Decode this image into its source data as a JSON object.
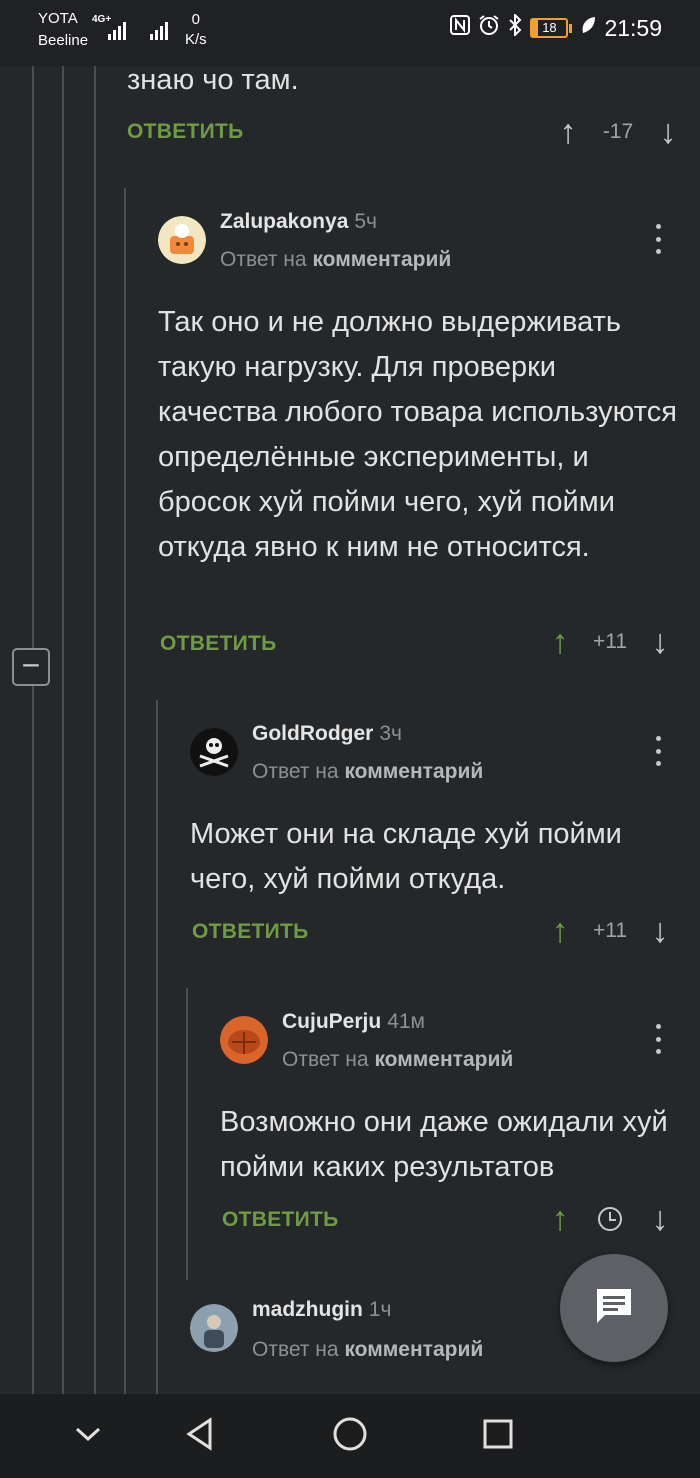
{
  "status_bar": {
    "carrier1": "YOTA",
    "carrier2": "Beeline",
    "network_type": "4G+",
    "speed_value": "0",
    "speed_unit": "K/s",
    "battery": "18",
    "time": "21:59"
  },
  "top_comment": {
    "text_tail": "знаю чо там.",
    "reply_label": "ОТВЕТИТЬ",
    "rating": "-17"
  },
  "comments": [
    {
      "username": "Zalupakonya",
      "time_ago": "5ч",
      "reply_prefix": "Ответ на",
      "reply_target": "комментарий",
      "text": "Так оно и не должно выдерживать такую нагрузку. Для проверки качества любого товара используются определённые эксперименты, и бросок хуй пойми чего, хуй пойми откуда явно к ним не относится.",
      "reply_label": "ОТВЕТИТЬ",
      "rating": "+11"
    },
    {
      "username": "GoldRodger",
      "time_ago": "3ч",
      "reply_prefix": "Ответ на",
      "reply_target": "комментарий",
      "text": "Может они на складе хуй пойми чего, хуй пойми откуда.",
      "reply_label": "ОТВЕТИТЬ",
      "rating": "+11"
    },
    {
      "username": "CujuPerju",
      "time_ago": "41м",
      "reply_prefix": "Ответ на",
      "reply_target": "комментарий",
      "text": "Возможно они даже ожидали хуй пойми каких результатов",
      "reply_label": "ОТВЕТИТЬ",
      "rating": ""
    },
    {
      "username": "madzhugin",
      "time_ago": "1ч",
      "reply_prefix": "Ответ на",
      "reply_target": "комментарий"
    }
  ],
  "colors": {
    "background": "#25282b",
    "accent_green": "#6f9a46",
    "muted_text": "#8c9095"
  },
  "icons": {
    "collapse": "minus-square-icon",
    "fab": "comment-icon",
    "nav": [
      "chevron-down-icon",
      "back-triangle-icon",
      "home-circle-icon",
      "recents-square-icon"
    ]
  }
}
